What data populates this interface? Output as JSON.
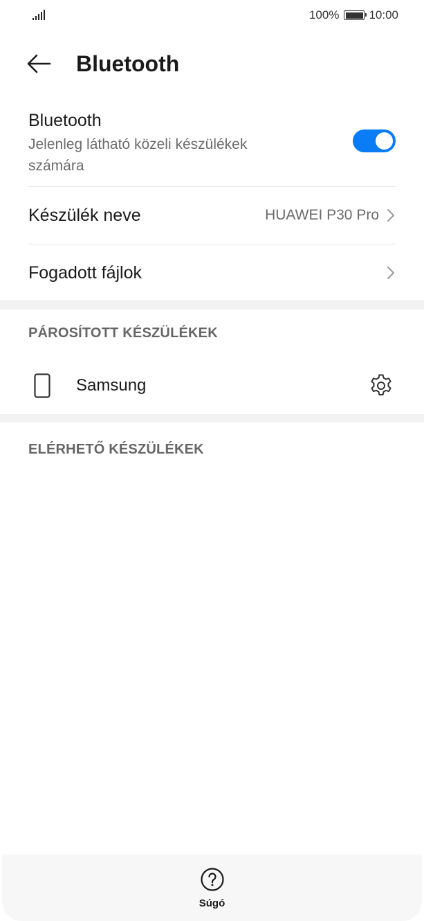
{
  "status_bar": {
    "battery": "100%",
    "time": "10:00"
  },
  "header": {
    "title": "Bluetooth"
  },
  "bluetooth": {
    "label": "Bluetooth",
    "subtitle": "Jelenleg látható közeli készülékek számára",
    "enabled": true,
    "accent_color": "#0a7cf5"
  },
  "device_name_row": {
    "label": "Készülék neve",
    "value": "HUAWEI P30 Pro"
  },
  "received_files_row": {
    "label": "Fogadott fájlok"
  },
  "paired_section": {
    "header": "PÁROSÍTOTT KÉSZÜLÉKEK",
    "devices": [
      {
        "name": "Samsung",
        "icon": "phone-icon"
      }
    ]
  },
  "available_section": {
    "header": "ELÉRHETŐ KÉSZÜLÉKEK"
  },
  "bottom_bar": {
    "help_label": "Súgó",
    "help_icon": "question-circle-icon"
  }
}
